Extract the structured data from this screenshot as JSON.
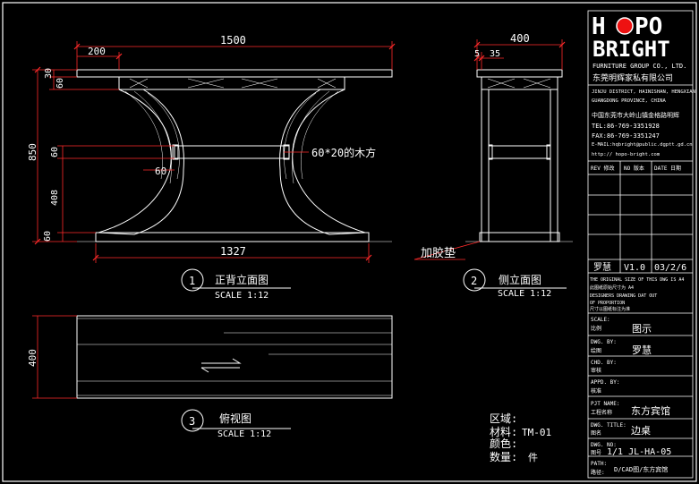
{
  "brand": {
    "logo_text_1": "H",
    "logo_text_2": "PO",
    "logo_text_3": "BRIGHT",
    "tagline_en": "FURNITURE GROUP CO., LTD.",
    "tagline_cn": "东莞明辉家私有限公司"
  },
  "company_info": {
    "addr_en_1": "JINJU DISTRICT, HAINISHAN, HENGXIAN",
    "addr_en_2": "GUANGDONG PROVINCE, CHINA",
    "addr_cn": "中国东莞市大岭山镇金格路明辉",
    "tel": "TEL:86-769-3351928",
    "fax": "FAX:86-769-3351247",
    "email": "E-MAIL:hqbright@public.dgptt.gd.cn",
    "web": "http:// hopo-bright.com"
  },
  "revision_table": {
    "col1": "REV 修改",
    "col2": "NO 版本",
    "col3": "DATE 日期",
    "row": {
      "author": "罗慧",
      "version": "V1.0",
      "date": "03/2/6"
    }
  },
  "notes": {
    "line1": "THE ORIGINAL SIZE OF THIS DWG IS A4",
    "line2": "此图纸原始尺寸为 A4",
    "line3": "DESIGNERS DRAWING DAT OUT",
    "line4": "OF PROPORTION",
    "line5": "尺寸以图纸标注为准"
  },
  "title_block": {
    "scale_label_en": "SCALE:",
    "scale_label_cn": "比例",
    "scale_value": "图示",
    "dwg_by_en": "DWG. BY:",
    "dwg_by_cn": "绘图",
    "dwg_by_value": "罗慧",
    "chd_by_en": "CHD. BY:",
    "chd_by_cn": "审核",
    "appd_by_en": "APPD. BY:",
    "appd_by_cn": "核准",
    "pjt_name_en": "PJT NAME:",
    "pjt_name_cn": "工程名称",
    "pjt_name_value": "东方宾馆",
    "dwg_title_en": "DWG. TITLE:",
    "dwg_title_cn": "图名",
    "dwg_title_value": "边桌",
    "dwg_no_en": "DWG. NO:",
    "dwg_no_cn": "图号",
    "dwg_no_value": "1/1 JL-HA-05",
    "path_en": "PATH:",
    "path_cn": "路径:",
    "path_value": "D/CAD图/东方宾馆"
  },
  "views": {
    "front": {
      "num": "1",
      "title": "正背立面图",
      "scale": "SCALE 1:12"
    },
    "side": {
      "num": "2",
      "title": "侧立面图",
      "scale": "SCALE 1:12"
    },
    "top": {
      "num": "3",
      "title": "俯视图",
      "scale": "SCALE 1:12"
    }
  },
  "dimensions": {
    "front_width": "1500",
    "front_left_offset": "200",
    "front_base_width": "1327",
    "front_height": "850",
    "top_thick_1": "30",
    "top_thick_2": "60",
    "rail_60": "60",
    "lower_408": "408",
    "base_60": "60",
    "post_60": "60",
    "side_width": "400",
    "side_5": "5",
    "side_35": "35",
    "top_depth": "400"
  },
  "annotations": {
    "wood_note": "60*20的木方",
    "rubber_pad": "加胶垫"
  },
  "material_info": {
    "area_label": "区域:",
    "material_label": "材料:",
    "material_value": "TM-01",
    "color_label": "颜色:",
    "qty_label": "数量:",
    "qty_value": "件"
  },
  "colors": {
    "background": "#000000",
    "lines": "#ffffff",
    "dimensions": "#ff2a2a"
  }
}
